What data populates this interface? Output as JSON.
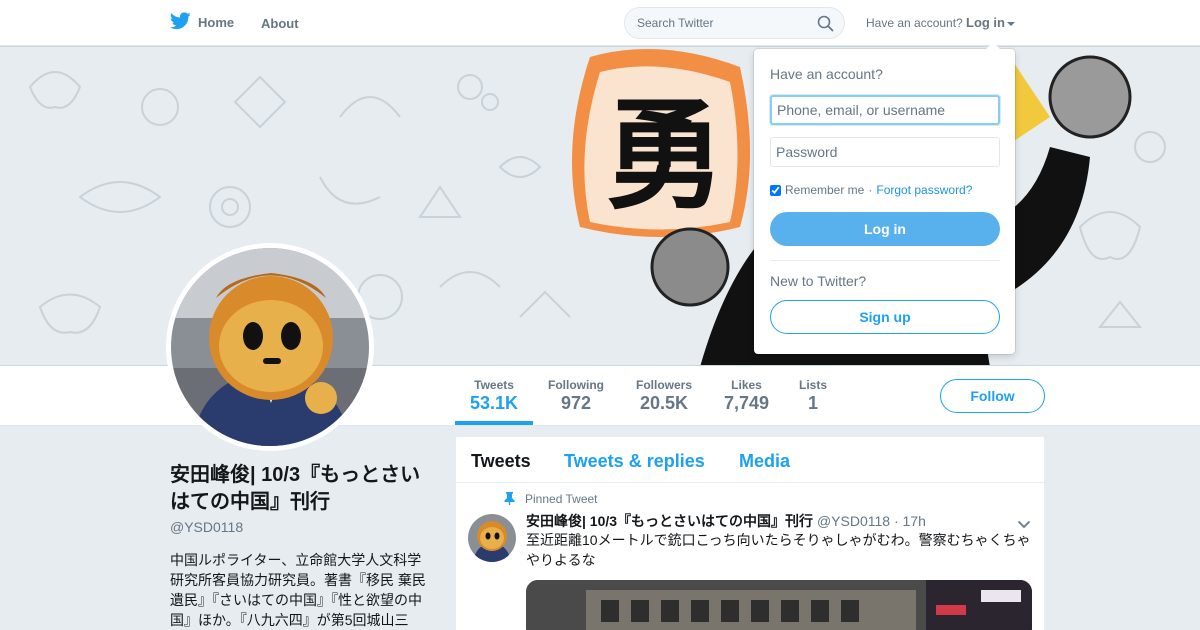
{
  "colors": {
    "brand": "#1da1f2",
    "text_secondary": "#657786",
    "background": "#e6ecf0"
  },
  "nav": {
    "home_label": "Home",
    "about_label": "About",
    "search_placeholder": "Search Twitter",
    "account_prompt": "Have an account?",
    "login_label": "Log in",
    "logo_icon": "twitter-bird-icon",
    "search_icon": "search-icon"
  },
  "banner": {
    "kanji": "勇"
  },
  "profile": {
    "name": "安田峰俊| 10/3『もっとさいはての中国』刊行",
    "handle": "@YSD0118",
    "bio": "中国ルポライター、立命館大学人文科学研究所客員協力研究員。著書『移民 棄民 遺民』『さいはての中国』『性と欲望の中国』ほか。『八九六四』が第5回城山三"
  },
  "stats": [
    {
      "label": "Tweets",
      "value": "53.1K"
    },
    {
      "label": "Following",
      "value": "972"
    },
    {
      "label": "Followers",
      "value": "20.5K"
    },
    {
      "label": "Likes",
      "value": "7,749"
    },
    {
      "label": "Lists",
      "value": "1"
    }
  ],
  "follow_label": "Follow",
  "timeline": {
    "tabs": [
      "Tweets",
      "Tweets & replies",
      "Media"
    ],
    "pinned_label": "Pinned Tweet",
    "tweet": {
      "name": "安田峰俊| 10/3『もっとさいはての中国』刊行",
      "handle": "@YSD0118",
      "time": "· 17h",
      "text": "至近距離10メートルで銃口こっち向いたらそりゃしゃがむわ。警察むちゃくちゃやりよるな"
    }
  },
  "login_dropdown": {
    "heading": "Have an account?",
    "username_placeholder": "Phone, email, or username",
    "password_placeholder": "Password",
    "remember_label": "Remember me",
    "separator": "·",
    "forgot_label": "Forgot password?",
    "login_button": "Log in",
    "new_prompt": "New to Twitter?",
    "signup_button": "Sign up"
  }
}
